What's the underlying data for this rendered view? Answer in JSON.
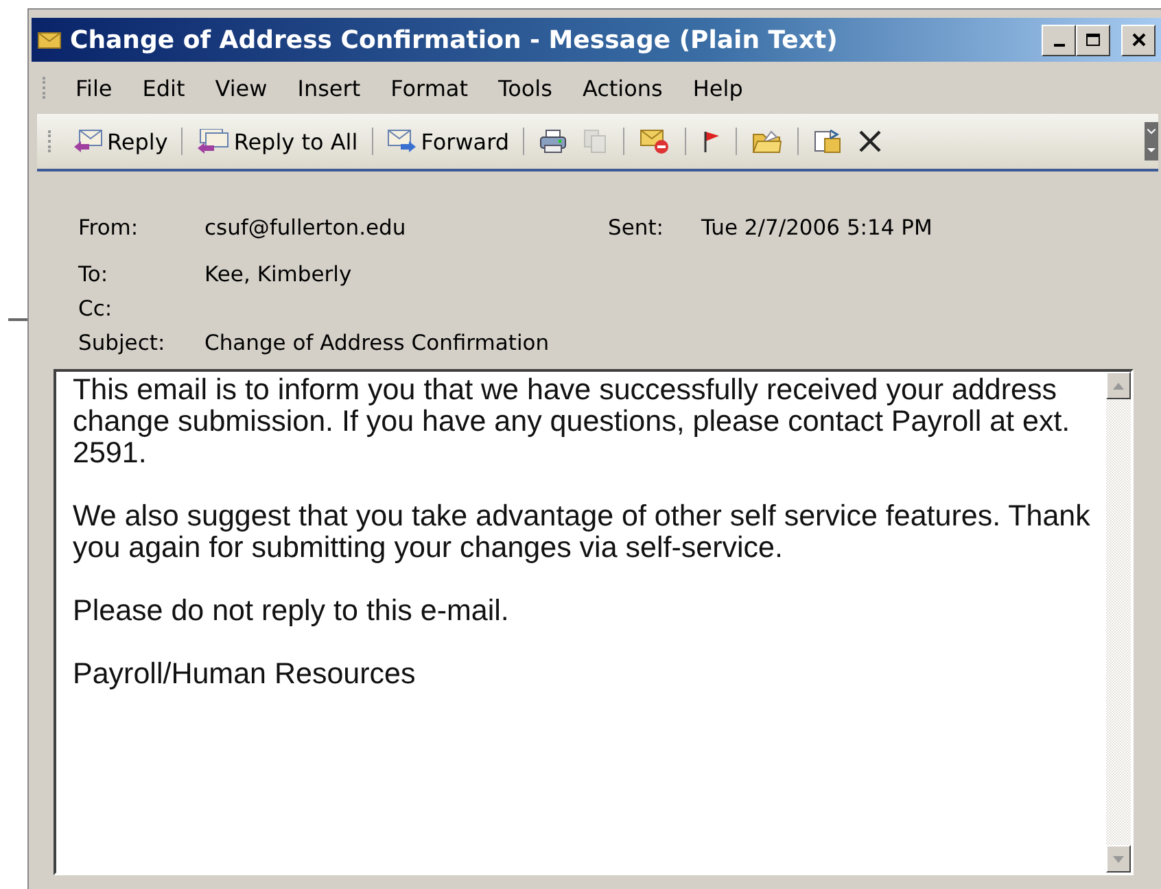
{
  "window": {
    "title": "Change of Address Confirmation - Message (Plain Text)"
  },
  "menu": [
    {
      "label": "File"
    },
    {
      "label": "Edit"
    },
    {
      "label": "View"
    },
    {
      "label": "Insert"
    },
    {
      "label": "Format"
    },
    {
      "label": "Tools"
    },
    {
      "label": "Actions"
    },
    {
      "label": "Help"
    }
  ],
  "toolbar": {
    "text_buttons": [
      {
        "label": "Reply"
      },
      {
        "label": "Reply to All"
      },
      {
        "label": "Forward"
      }
    ],
    "icon_buttons": [
      {
        "disabled": false
      },
      {
        "disabled": true
      },
      {
        "disabled": false
      },
      {
        "disabled": false
      },
      {
        "disabled": false
      },
      {
        "disabled": false
      },
      {
        "disabled": false
      }
    ]
  },
  "header": {
    "from": {
      "label": "From:",
      "value": "csuf@fullerton.edu"
    },
    "sent": {
      "label": "Sent:",
      "value": "Tue 2/7/2006 5:14 PM"
    },
    "to": {
      "label": "To:",
      "value": "Kee, Kimberly"
    },
    "cc": {
      "label": "Cc:"
    },
    "subject": {
      "label": "Subject:",
      "value": "Change of Address Confirmation"
    }
  },
  "body": [
    "This email is to inform you that we have successfully received your address change submission. If you have any questions, please contact Payroll at ext. 2591.",
    "We also suggest that you take advantage of other self service features. Thank you again for submitting your changes via self-service.",
    "Please do not reply to this e-mail.",
    "Payroll/Human Resources"
  ]
}
